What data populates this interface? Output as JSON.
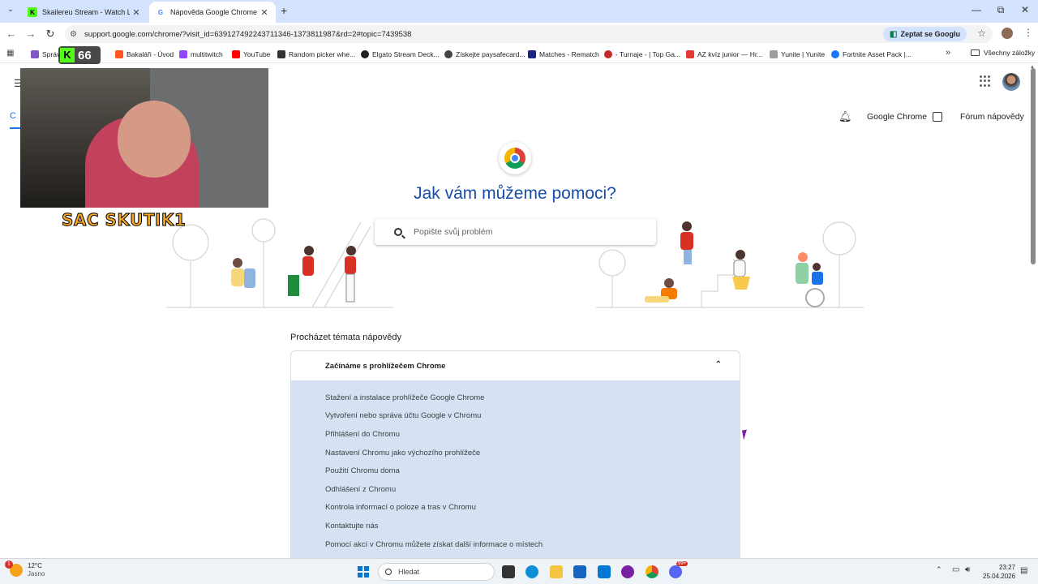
{
  "browser": {
    "tabs": [
      {
        "title": "Skailereu Stream - Watch Live o",
        "active": false
      },
      {
        "title": "Nápověda Google Chrome",
        "active": true
      }
    ],
    "new_tab_label": "+",
    "window_controls": {
      "minimize": "—",
      "maximize": "⧉",
      "close": "✕"
    },
    "url": "support.google.com/chrome/?visit_id=639127492243711346-1373811987&rd=2#topic=7439538",
    "ask_google_label": "Zeptat se Googlu",
    "nav_back": "←",
    "nav_forward": "→",
    "nav_reload": "↻"
  },
  "bookmarks": {
    "items": [
      {
        "label": "Správ",
        "color": "#7e57c2"
      },
      {
        "label": "Bakaláři - Úvod",
        "color": "#ff5722"
      },
      {
        "label": "multitwitch",
        "color": "#9146ff"
      },
      {
        "label": "YouTube",
        "color": "#ff0000"
      },
      {
        "label": "Random picker whe...",
        "color": "#333333"
      },
      {
        "label": "Elgato Stream Deck...",
        "color": "#202124"
      },
      {
        "label": "Získejte paysafecard...",
        "color": "#444444"
      },
      {
        "label": "Matches - Rematch",
        "color": "#1a237e"
      },
      {
        "label": "- Turnaje - | Top Ga...",
        "color": "#c62828"
      },
      {
        "label": "AZ kvíz junior — Hr...",
        "color": "#e53935"
      },
      {
        "label": "Yunite | Yunite",
        "color": "#9e9e9e"
      },
      {
        "label": "Fortnite Asset Pack |...",
        "color": "#1877f2"
      }
    ],
    "more": "»",
    "all_bookmarks": "Všechny záložky"
  },
  "page": {
    "product_tab": "C",
    "header_links": {
      "chrome": "Google Chrome",
      "forum": "Fórum nápovědy"
    },
    "hero_title": "Jak vám můžeme pomoci?",
    "search_placeholder": "Popište svůj problém",
    "browse_heading": "Procházet témata nápovědy",
    "topic_section": {
      "title": "Začínáme s prohlížečem Chrome",
      "items": [
        "Stažení a instalace prohlížeče Google Chrome",
        "Vytvoření nebo správa účtu Google v Chromu",
        "Přihlášení do Chromu",
        "Nastavení Chromu jako výchozího prohlížeče",
        "Použití Chromu doma",
        "Odhlášení z Chromu",
        "Kontrola informací o poloze a tras v Chromu",
        "Kontaktujte nás",
        "Pomocí akcí v Chromu můžete získat další informace o místech"
      ]
    }
  },
  "stream_overlay": {
    "viewer_count": "66",
    "kick_letter": "K",
    "streamer_name": "SAC SKUTIK1"
  },
  "taskbar": {
    "weather_temp": "12°C",
    "weather_desc": "Jasno",
    "weather_badge": "1",
    "search_label": "Hledat",
    "time": "23:27",
    "date": "25.04.2026",
    "chat_badge": "99+"
  }
}
